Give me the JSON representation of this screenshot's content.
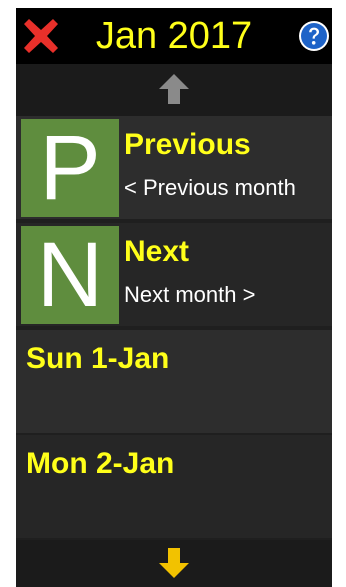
{
  "header": {
    "title": "Jan 2017",
    "close_icon": "red-x-close-icon",
    "help_icon": "blue-question-help-icon"
  },
  "scroll": {
    "up_icon": "gray-up-arrow-icon",
    "down_icon": "yellow-down-arrow-icon"
  },
  "items": [
    {
      "letter": "P",
      "title": "Previous",
      "subtitle": "< Previous month"
    },
    {
      "letter": "N",
      "title": "Next",
      "subtitle": "Next month >"
    }
  ],
  "days": [
    {
      "label": "Sun  1-Jan"
    },
    {
      "label": "Mon  2-Jan"
    }
  ],
  "colors": {
    "accent_yellow": "#ffff1a",
    "icon_green": "#5f8d3e",
    "close_red": "#e8302a",
    "help_blue": "#1e63c8",
    "background": "#1f1f1f"
  }
}
